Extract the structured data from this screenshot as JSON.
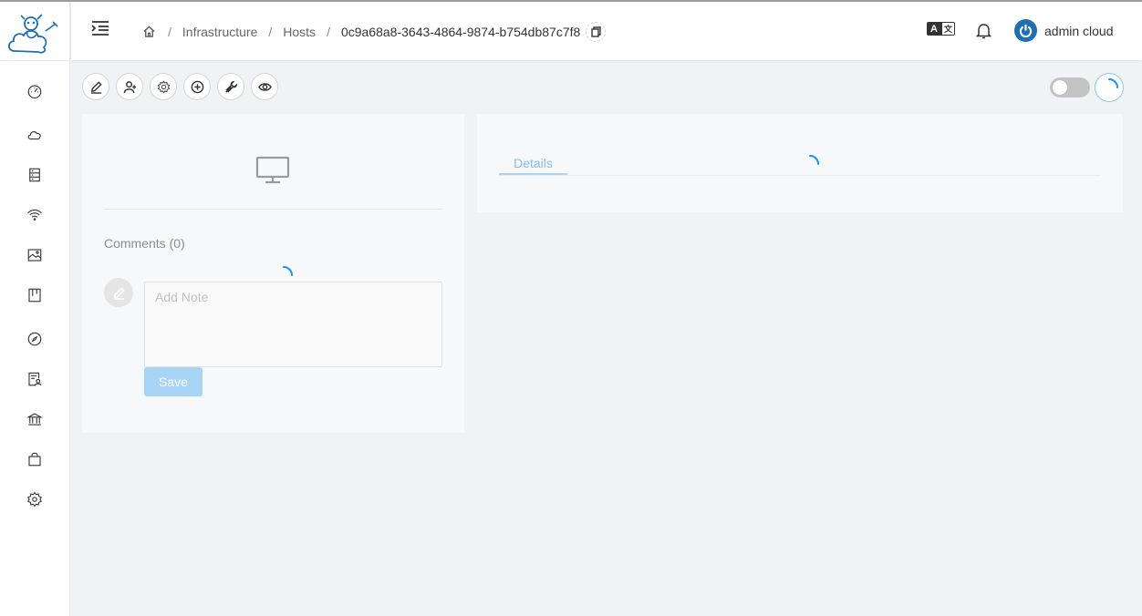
{
  "header": {
    "breadcrumb": {
      "items": [
        "Infrastructure",
        "Hosts"
      ],
      "current": "0c9a68a8-3643-4864-9874-b754db87c7f8",
      "separator": "/"
    },
    "user": {
      "name": "admin cloud"
    }
  },
  "sidebar": {
    "items": [
      {
        "icon": "dashboard-icon"
      },
      {
        "icon": "cloud-icon"
      },
      {
        "icon": "storage-icon"
      },
      {
        "icon": "wifi-icon"
      },
      {
        "icon": "image-icon"
      },
      {
        "icon": "events-icon"
      },
      {
        "icon": "compass-icon"
      },
      {
        "icon": "account-icon"
      },
      {
        "icon": "bank-icon"
      },
      {
        "icon": "shopping-bag-icon"
      },
      {
        "icon": "gear-icon"
      }
    ]
  },
  "toolbar": {
    "actions": [
      "edit-icon",
      "add-user-icon",
      "gear-icon",
      "plus-circle-icon",
      "wrench-icon",
      "eye-icon"
    ]
  },
  "comments": {
    "title": "Comments (0)",
    "note_placeholder": "Add Note",
    "save_label": "Save"
  },
  "details": {
    "tab_label": "Details"
  },
  "colors": {
    "accent": "#1f6fb3",
    "tab_active": "#84bde8",
    "save_disabled": "#a8d4f5",
    "spinner": "#1890ff"
  }
}
